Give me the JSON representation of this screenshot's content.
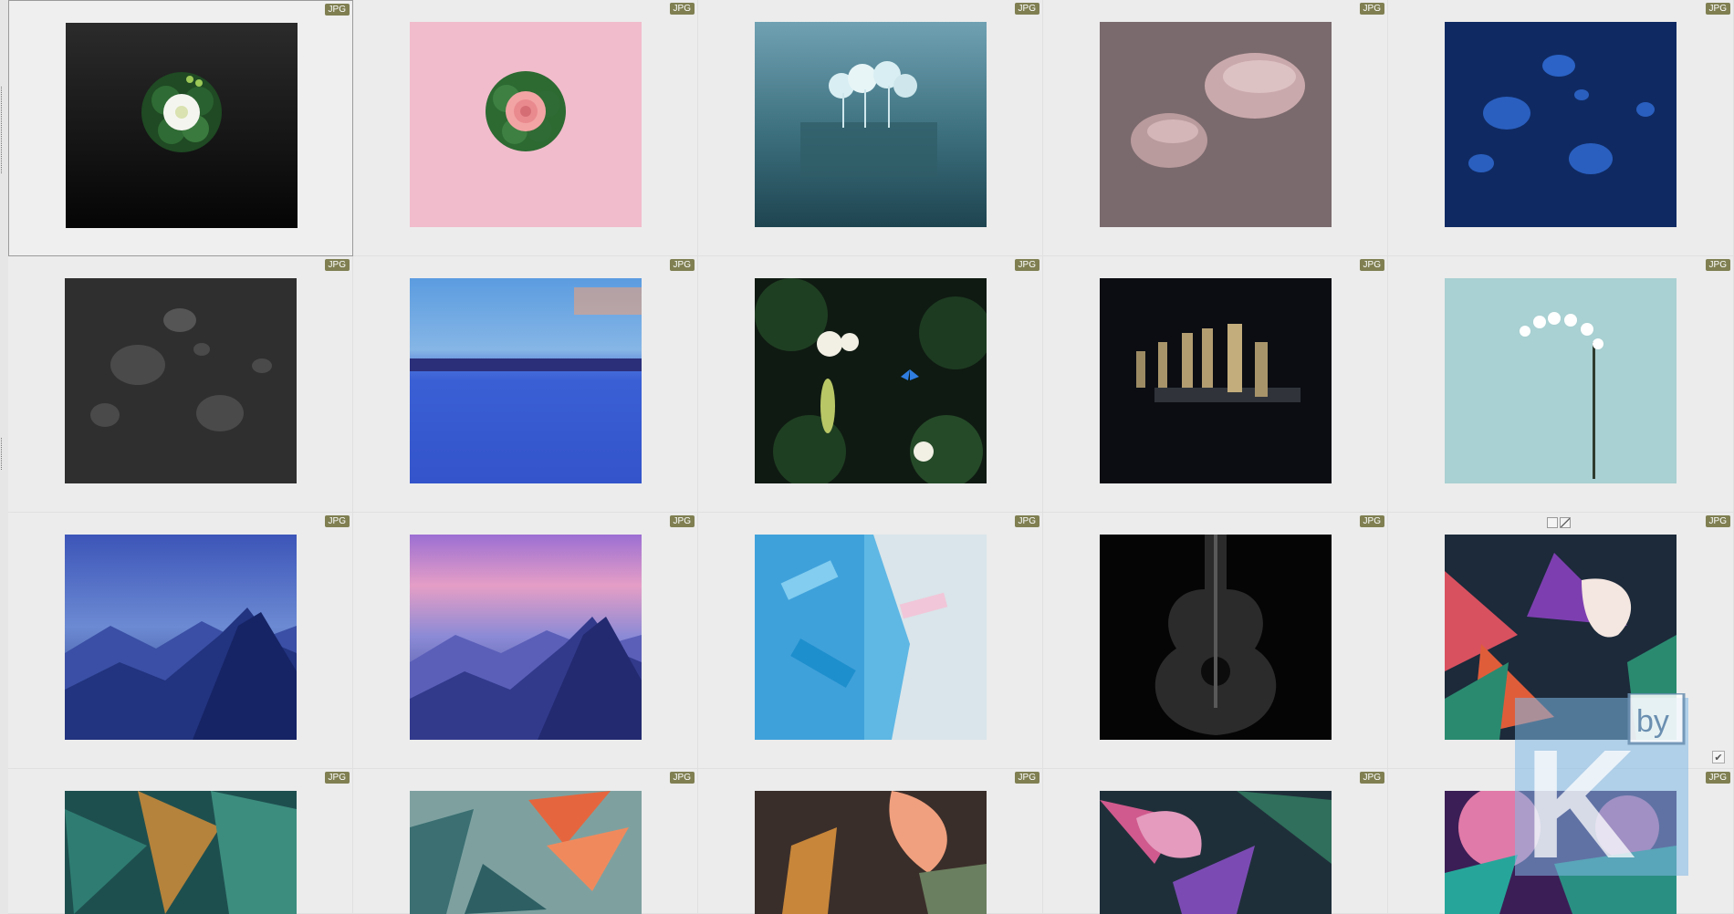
{
  "badge_label": "JPG",
  "thumbnails": [
    [
      {
        "name": "thumb-white-flower-black",
        "badge": "JPG"
      },
      {
        "name": "thumb-pink-rose-pink",
        "badge": "JPG"
      },
      {
        "name": "thumb-misty-island-trees",
        "badge": "JPG"
      },
      {
        "name": "thumb-pink-pebbles",
        "badge": "JPG"
      },
      {
        "name": "thumb-blue-water-drops",
        "badge": "JPG"
      }
    ],
    [
      {
        "name": "thumb-black-water-drops",
        "badge": "JPG"
      },
      {
        "name": "thumb-abstract-blue-landscape",
        "badge": "JPG"
      },
      {
        "name": "thumb-tropical-leaves-butterfly",
        "badge": "JPG"
      },
      {
        "name": "thumb-chess-pieces",
        "badge": "JPG"
      },
      {
        "name": "thumb-white-orchid",
        "badge": "JPG"
      }
    ],
    [
      {
        "name": "thumb-blue-mountains",
        "badge": "JPG"
      },
      {
        "name": "thumb-pink-sky-mountains",
        "badge": "JPG"
      },
      {
        "name": "thumb-blue-paint-texture",
        "badge": "JPG"
      },
      {
        "name": "thumb-acoustic-guitar",
        "badge": "JPG"
      },
      {
        "name": "thumb-calla-lily-tropical",
        "badge": "JPG"
      }
    ],
    [
      {
        "name": "thumb-teal-leaves",
        "badge": "JPG"
      },
      {
        "name": "thumb-bird-of-paradise",
        "badge": "JPG"
      },
      {
        "name": "thumb-orange-lilies",
        "badge": "JPG"
      },
      {
        "name": "thumb-purple-tropical-flowers",
        "badge": "JPG"
      },
      {
        "name": "thumb-pink-teal-flowers",
        "badge": "JPG"
      }
    ]
  ],
  "selected_index": 0,
  "colors": {
    "badge_bg": "#7f7f52",
    "panel_bg": "#ebebeb"
  },
  "watermark": {
    "text_main": "K",
    "text_small": "by"
  }
}
